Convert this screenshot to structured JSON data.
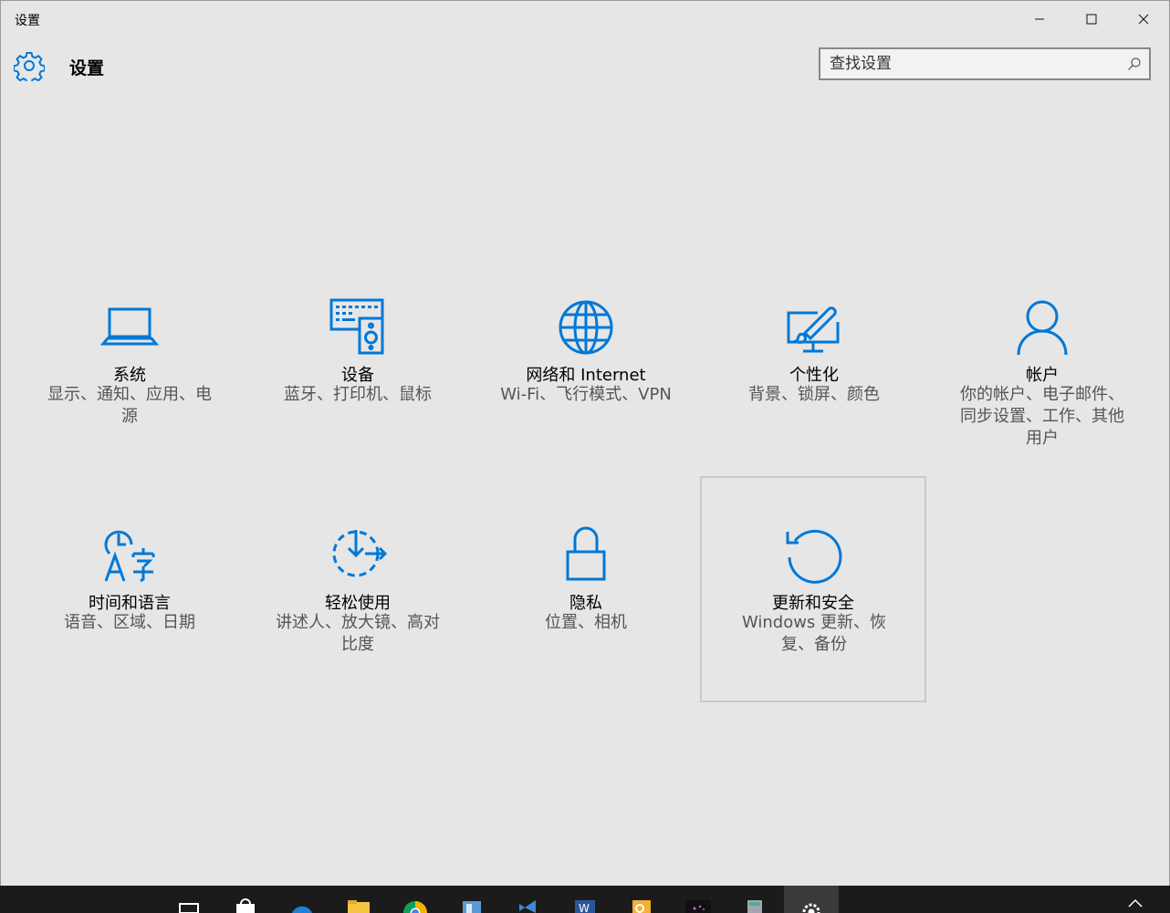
{
  "window": {
    "title": "设置"
  },
  "header": {
    "title": "设置",
    "search_placeholder": "查找设置"
  },
  "tiles": [
    {
      "label": "系统",
      "desc": "显示、通知、应用、电源",
      "icon": "laptop-icon"
    },
    {
      "label": "设备",
      "desc": "蓝牙、打印机、鼠标",
      "icon": "devices-icon"
    },
    {
      "label": "网络和 Internet",
      "desc": "Wi-Fi、飞行模式、VPN",
      "icon": "globe-icon"
    },
    {
      "label": "个性化",
      "desc": "背景、锁屏、颜色",
      "icon": "paint-screen-icon"
    },
    {
      "label": "帐户",
      "desc": "你的帐户、电子邮件、同步设置、工作、其他用户",
      "icon": "person-icon"
    },
    {
      "label": "时间和语言",
      "desc": "语音、区域、日期",
      "icon": "time-language-icon"
    },
    {
      "label": "轻松使用",
      "desc": "讲述人、放大镜、高对比度",
      "icon": "ease-of-access-icon"
    },
    {
      "label": "隐私",
      "desc": "位置、相机",
      "icon": "lock-icon"
    },
    {
      "label": "更新和安全",
      "desc": "Windows 更新、恢复、备份",
      "icon": "update-icon",
      "selected": true
    }
  ],
  "colors": {
    "accent": "#0078d7",
    "background": "#e6e6e6",
    "taskbar": "#1b1b1b"
  },
  "taskbar": {
    "items": [
      "task-view-icon",
      "store-icon",
      "edge-icon",
      "file-explorer-icon",
      "chrome-icon",
      "app-icon",
      "visual-studio-icon",
      "word-icon",
      "outlook-icon",
      "media-app-icon",
      "calculator-icon",
      "settings-icon"
    ]
  }
}
